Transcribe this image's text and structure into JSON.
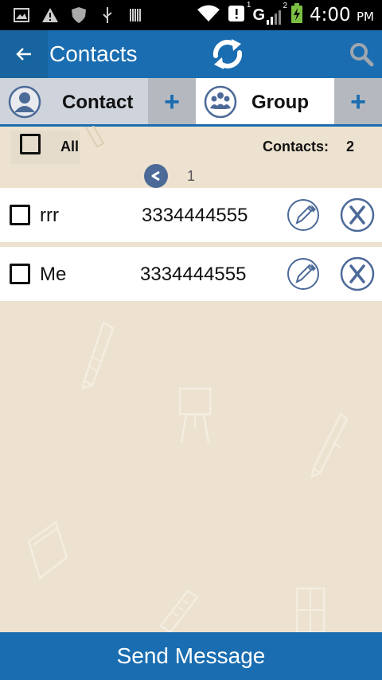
{
  "status_bar": {
    "time": "4:00",
    "ampm": "PM",
    "signal_label": "G",
    "sim_badge_1": "1",
    "sim_badge_2": "2"
  },
  "app_bar": {
    "title": "Contacts"
  },
  "tabs": {
    "contact": {
      "label": "Contact",
      "add": "+"
    },
    "group": {
      "label": "Group",
      "add": "+"
    }
  },
  "summary": {
    "all_label": "All",
    "contacts_label": "Contacts:",
    "contacts_count": "2"
  },
  "pager": {
    "page": "1"
  },
  "contacts": [
    {
      "name": "rrr",
      "phone": "3334444555"
    },
    {
      "name": "Me",
      "phone": "3334444555"
    }
  ],
  "send_button": {
    "label": "Send Message"
  },
  "colors": {
    "primary": "#1a6db0",
    "background": "#ece2cf",
    "icon_stroke": "#4c6a98"
  }
}
